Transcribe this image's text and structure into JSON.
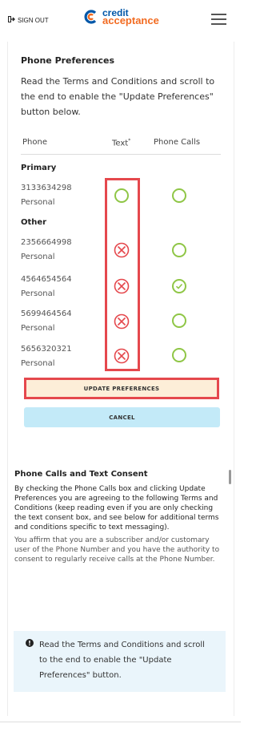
{
  "header": {
    "signout_label": "SIGN OUT",
    "logo_line1": "credit",
    "logo_line2": "acceptance"
  },
  "preferences": {
    "title": "Phone Preferences",
    "intro": "Read the Terms and Conditions and scroll to the end to enable the \"Update Preferences\" button below.",
    "columns": {
      "phone": "Phone",
      "text": "Text",
      "text_sup": "*",
      "calls": "Phone Calls"
    },
    "groups": {
      "primary": "Primary",
      "other": "Other"
    },
    "rows": [
      {
        "number": "3133634298",
        "type": "Personal",
        "text_state": "empty",
        "call_state": "empty"
      },
      {
        "number": "2356664998",
        "type": "Personal",
        "text_state": "blocked",
        "call_state": "empty"
      },
      {
        "number": "4564654564",
        "type": "Personal",
        "text_state": "blocked",
        "call_state": "checked"
      },
      {
        "number": "5699464564",
        "type": "Personal",
        "text_state": "blocked",
        "call_state": "empty"
      },
      {
        "number": "5656320321",
        "type": "Personal",
        "text_state": "blocked",
        "call_state": "empty"
      }
    ],
    "update_label": "UPDATE PREFERENCES",
    "cancel_label": "CANCEL"
  },
  "consent": {
    "title": "Phone Calls and Text Consent",
    "para1": "By checking the Phone Calls box and clicking Update Preferences you are agreeing to the following Terms and Conditions (keep reading even if you are only checking the text consent box, and see below for additional terms and conditions specific to text messaging).",
    "para2": "You affirm that you are a subscriber and/or customary user of the Phone Number and you have the authority to consent to regularly receive calls at the Phone Number."
  },
  "info": {
    "icon": "info-icon",
    "text": "Read the Terms and Conditions and scroll to the end to enable the \"Update Preferences\" button."
  },
  "colors": {
    "brand_blue": "#0057a8",
    "brand_orange": "#f26b21",
    "green": "#8fc646",
    "red": "#e5484d",
    "highlight": "#e5484d"
  }
}
